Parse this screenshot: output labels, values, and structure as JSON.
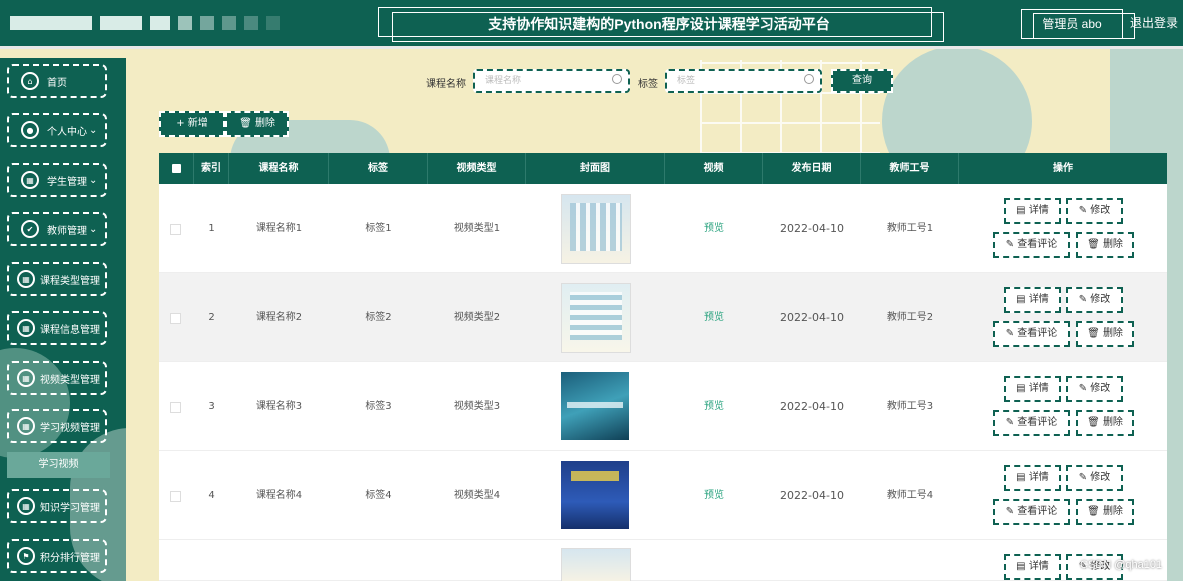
{
  "header": {
    "title": "支持协作知识建构的Python程序设计课程学习活动平台",
    "admin_label": "管理员 abo",
    "logout_label": "退出登录"
  },
  "sidebar": {
    "items": [
      {
        "label": "首页",
        "icon": "home-icon"
      },
      {
        "label": "个人中心",
        "icon": "user-icon",
        "has_dropdown": true
      },
      {
        "label": "学生管理",
        "icon": "grid-icon",
        "has_dropdown": true
      },
      {
        "label": "教师管理",
        "icon": "thumb-icon",
        "has_dropdown": true
      },
      {
        "label": "课程类型管理",
        "icon": "grid-icon"
      },
      {
        "label": "课程信息管理",
        "icon": "grid-icon"
      },
      {
        "label": "视频类型管理",
        "icon": "grid-icon"
      },
      {
        "label": "学习视频管理",
        "icon": "grid-icon"
      },
      {
        "label": "知识学习管理",
        "icon": "grid-icon"
      },
      {
        "label": "积分排行管理",
        "icon": "flag-icon"
      }
    ],
    "active_sub": "学习视频"
  },
  "search": {
    "course_label": "课程名称",
    "course_placeholder": "课程名称",
    "tag_label": "标签",
    "tag_placeholder": "标签",
    "search_button": "查询"
  },
  "toolbar": {
    "add_label": "+ 新增",
    "delete_label": "删除"
  },
  "table": {
    "columns": [
      "索引",
      "课程名称",
      "标签",
      "视频类型",
      "封面图",
      "视频",
      "发布日期",
      "教师工号",
      "操作"
    ],
    "rows": [
      {
        "index": "1",
        "course": "课程名称1",
        "tag": "标签1",
        "video_type": "视频类型1",
        "video": "预览",
        "date": "2022-04-10",
        "teacher": "教师工号1"
      },
      {
        "index": "2",
        "course": "课程名称2",
        "tag": "标签2",
        "video_type": "视频类型2",
        "video": "预览",
        "date": "2022-04-10",
        "teacher": "教师工号2"
      },
      {
        "index": "3",
        "course": "课程名称3",
        "tag": "标签3",
        "video_type": "视频类型3",
        "video": "预览",
        "date": "2022-04-10",
        "teacher": "教师工号3"
      },
      {
        "index": "4",
        "course": "课程名称4",
        "tag": "标签4",
        "video_type": "视频类型4",
        "video": "预览",
        "date": "2022-04-10",
        "teacher": "教师工号4"
      }
    ],
    "actions": {
      "detail": "详情",
      "edit": "修改",
      "comments": "查看评论",
      "delete": "删除"
    }
  },
  "watermark": "CSDN @qha101",
  "colors": {
    "primary": "#0e6152",
    "background": "#f3ecc4",
    "preview": "#2aa37f"
  }
}
